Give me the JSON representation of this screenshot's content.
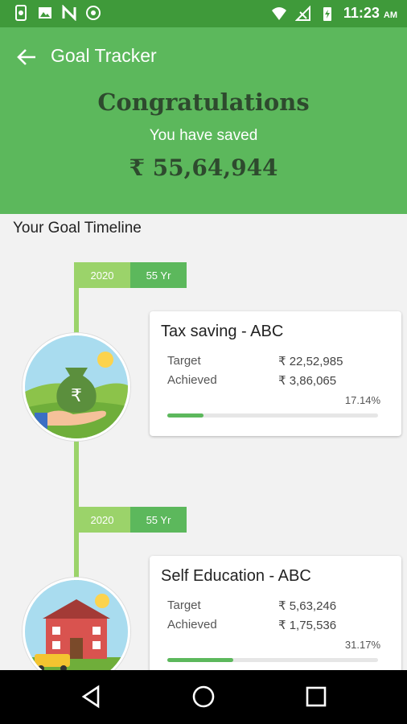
{
  "status_bar": {
    "time": "11:23",
    "ampm": "AM"
  },
  "header": {
    "title": "Goal Tracker",
    "congrats": "Congratulations",
    "saved_label": "You have saved",
    "saved_amount": "₹ 55,64,944"
  },
  "timeline": {
    "heading": "Your Goal Timeline",
    "goals": [
      {
        "year": "2020",
        "duration": "55 Yr",
        "title": "Tax  saving - ABC",
        "target_label": "Target",
        "target_value": "₹ 22,52,985",
        "achieved_label": "Achieved",
        "achieved_value": "₹ 3,86,065",
        "percent": "17.14%",
        "progress": 0.1714,
        "icon": "money-bag-hand-icon"
      },
      {
        "year": "2020",
        "duration": "55 Yr",
        "title": "Self Education - ABC",
        "target_label": "Target",
        "target_value": "₹ 5,63,246",
        "achieved_label": "Achieved",
        "achieved_value": "₹ 1,75,536",
        "percent": "31.17%",
        "progress": 0.3117,
        "icon": "school-building-icon"
      }
    ]
  },
  "colors": {
    "primary": "#5cb85c",
    "primary_dark": "#3f9a3a",
    "accent_light": "#9bd36a",
    "text_dark": "#2e4a2e"
  }
}
